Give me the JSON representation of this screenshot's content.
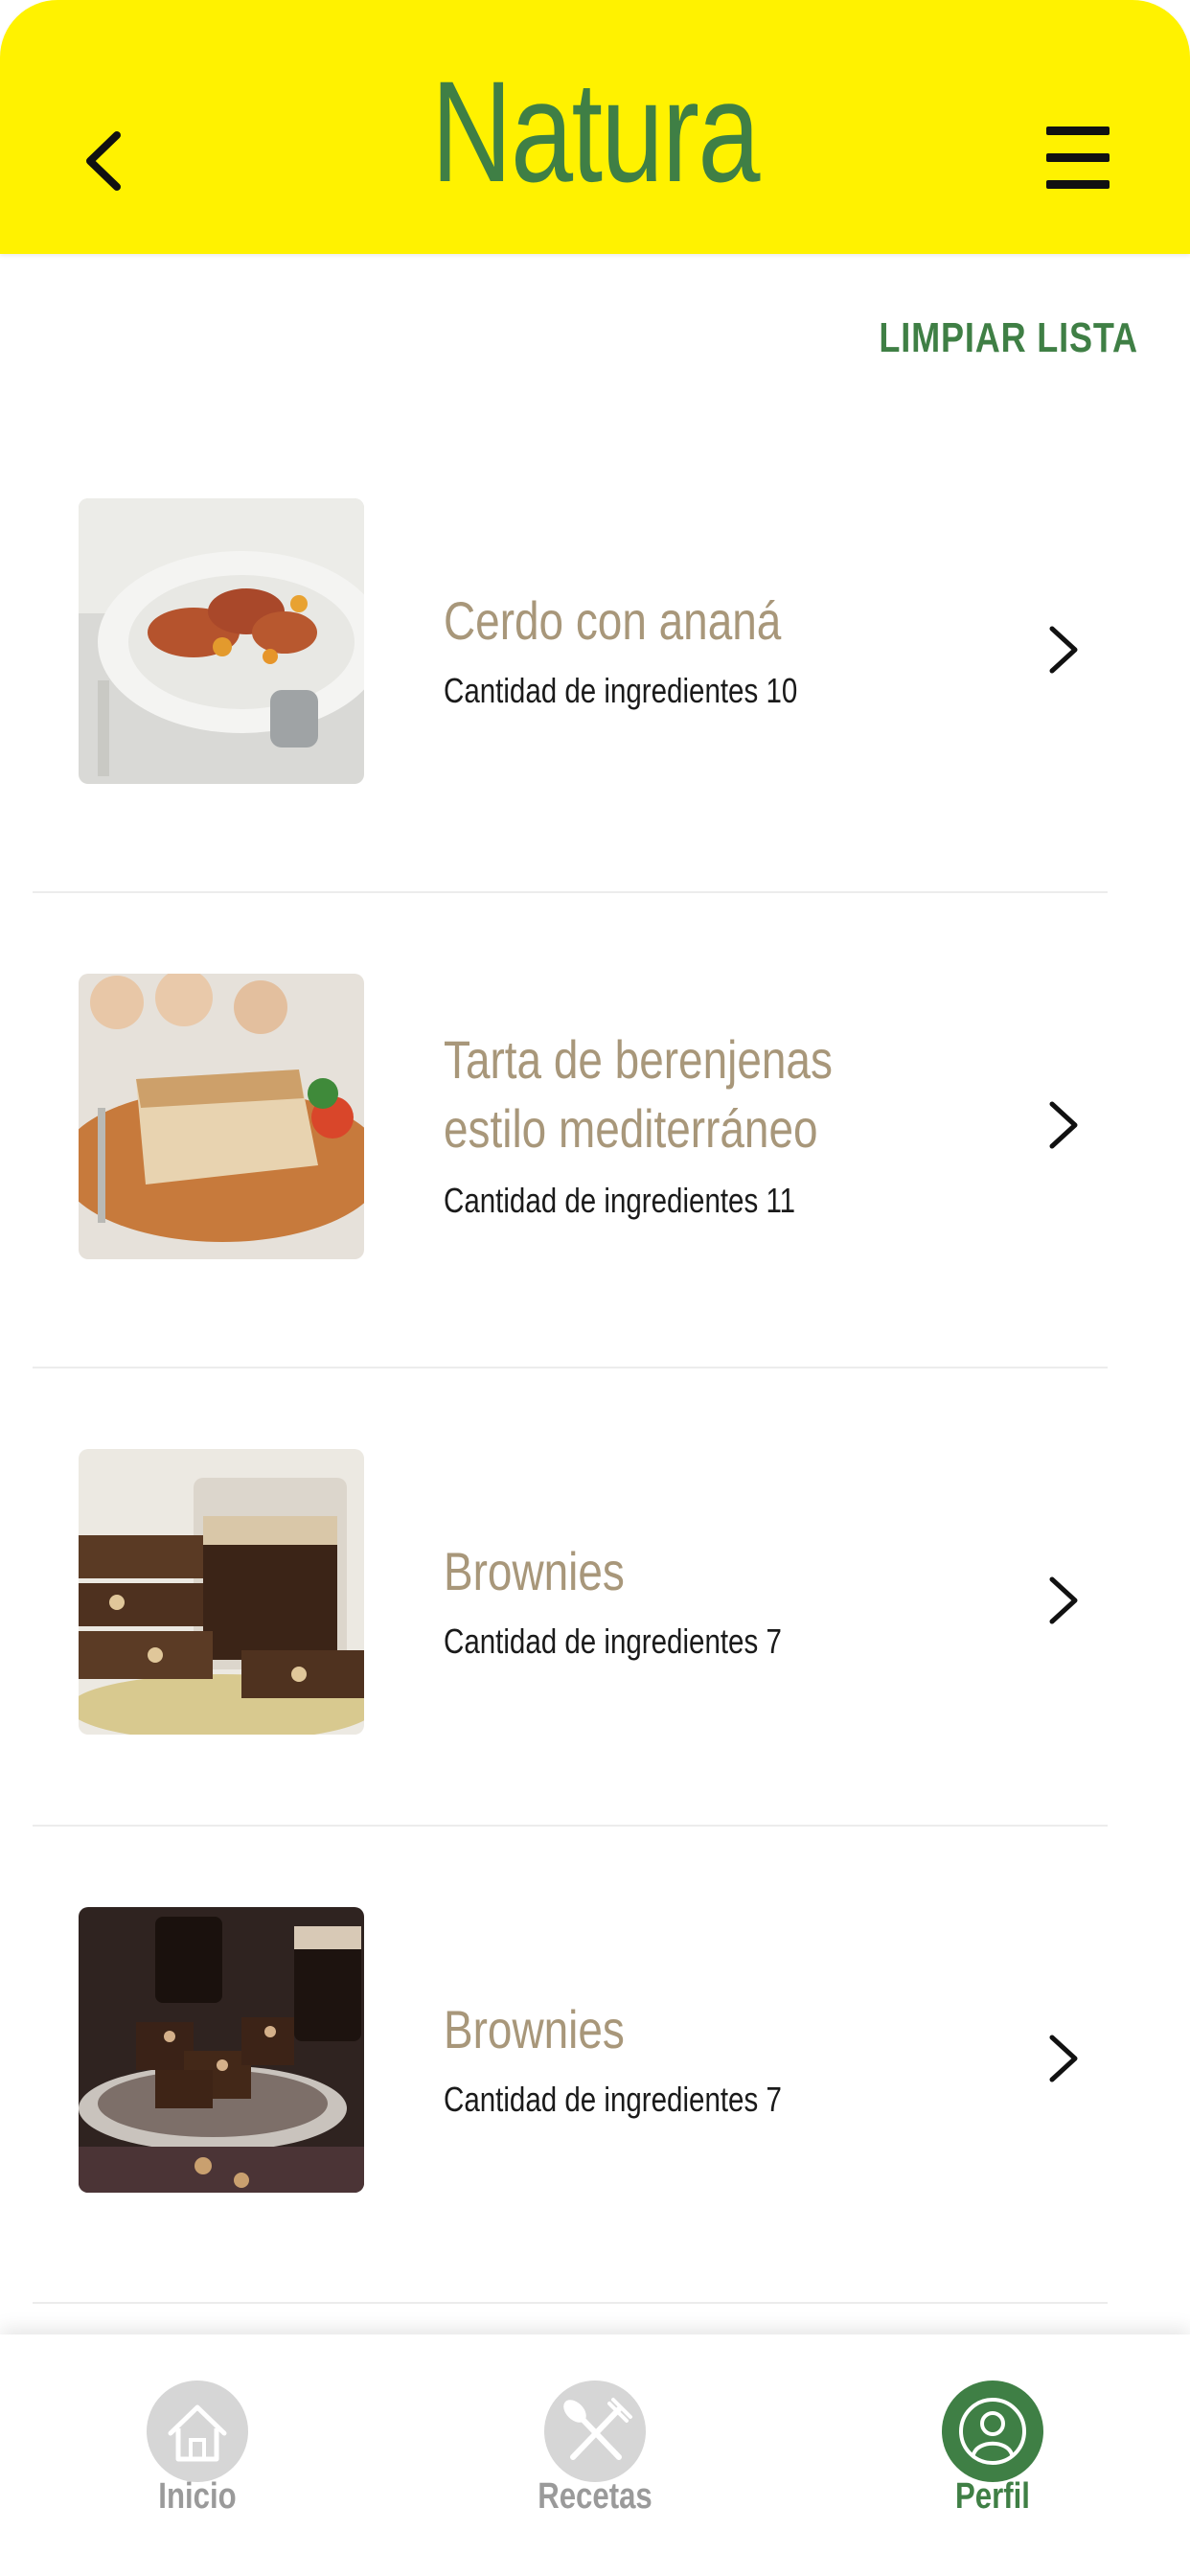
{
  "header": {
    "logo_text": "Natura",
    "back_icon": "chevron-left-icon",
    "menu_icon": "hamburger-menu-icon",
    "background_color": "#fff200",
    "logo_color": "#3f7f45"
  },
  "actions": {
    "clear_list_label": "LIMPIAR LISTA"
  },
  "recipes": [
    {
      "title": "Cerdo con ananá",
      "subtitle": "Cantidad de ingredientes 10",
      "image": "pork-with-pineapple-photo"
    },
    {
      "title": "Tarta de berenjenas estilo mediterráneo",
      "subtitle": "Cantidad de ingredientes 11",
      "image": "eggplant-tart-photo"
    },
    {
      "title": "Brownies",
      "subtitle": "Cantidad de ingredientes 7",
      "image": "brownies-coffee-photo"
    },
    {
      "title": "Brownies",
      "subtitle": "Cantidad de ingredientes 7",
      "image": "brownies-plate-photo"
    }
  ],
  "tabbar": {
    "items": [
      {
        "label": "Inicio",
        "icon": "home-icon",
        "active": false
      },
      {
        "label": "Recetas",
        "icon": "fork-knife-icon",
        "active": false
      },
      {
        "label": "Perfil",
        "icon": "user-profile-icon",
        "active": true
      }
    ],
    "active_color": "#3f7f45",
    "inactive_color": "#9a9a9a"
  },
  "colors": {
    "recipe_title": "#a8977a",
    "accent_green": "#3f7f45"
  }
}
